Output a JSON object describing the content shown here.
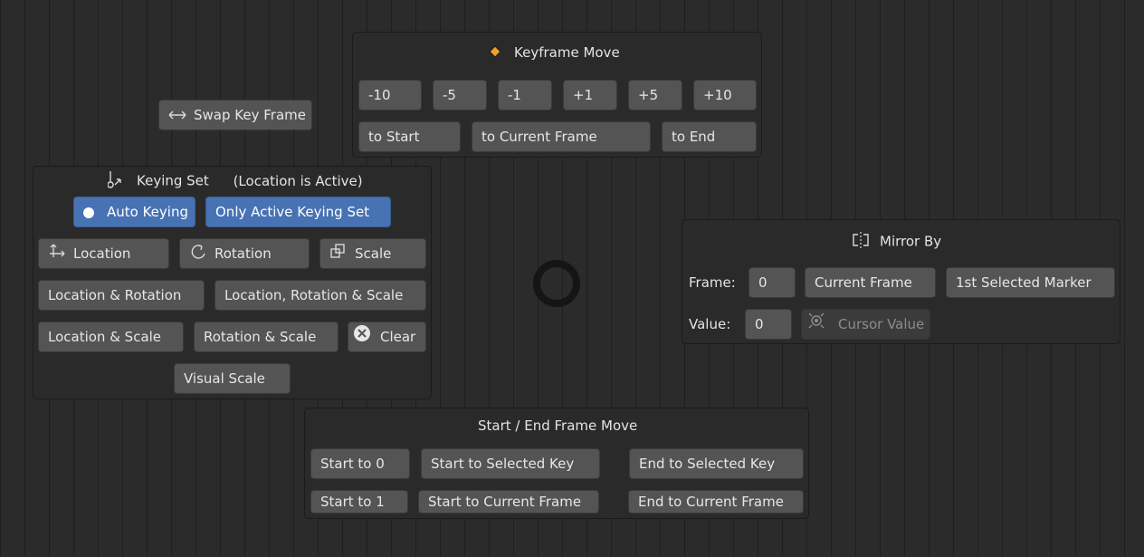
{
  "swap_button": {
    "label": "Swap Key Frame",
    "icon": "swap-arrows-icon"
  },
  "keyframe_move": {
    "title": "Keyframe Move",
    "icon": "keyframe-diamond-icon",
    "accent": "#f0a030",
    "offsets": [
      "-10",
      "-5",
      "-1",
      "+1",
      "+5",
      "+10"
    ],
    "to_start": "to Start",
    "to_current": "to Current Frame",
    "to_end": "to End"
  },
  "keying_set": {
    "title": "Keying Set",
    "status": "(Location is Active)",
    "auto_keying": "Auto Keying",
    "only_active": "Only Active Keying Set",
    "location": "Location",
    "rotation": "Rotation",
    "scale": "Scale",
    "loc_rot": "Location & Rotation",
    "loc_rot_scale": "Location, Rotation & Scale",
    "loc_scale": "Location & Scale",
    "rot_scale": "Rotation & Scale",
    "clear": "Clear",
    "visual_scale": "Visual Scale",
    "active_color": "#4772b3"
  },
  "mirror_by": {
    "title": "Mirror By",
    "frame_label": "Frame:",
    "frame_value": "0",
    "current_frame": "Current Frame",
    "first_marker": "1st Selected Marker",
    "value_label": "Value:",
    "value_value": "0",
    "cursor_value": "Cursor Value"
  },
  "start_end": {
    "title": "Start / End Frame Move",
    "start_to_0": "Start to 0",
    "start_to_selected": "Start to Selected Key",
    "end_to_selected": "End to Selected Key",
    "start_to_1": "Start to 1",
    "start_to_current": "Start to Current Frame",
    "end_to_current": "End to Current Frame"
  }
}
